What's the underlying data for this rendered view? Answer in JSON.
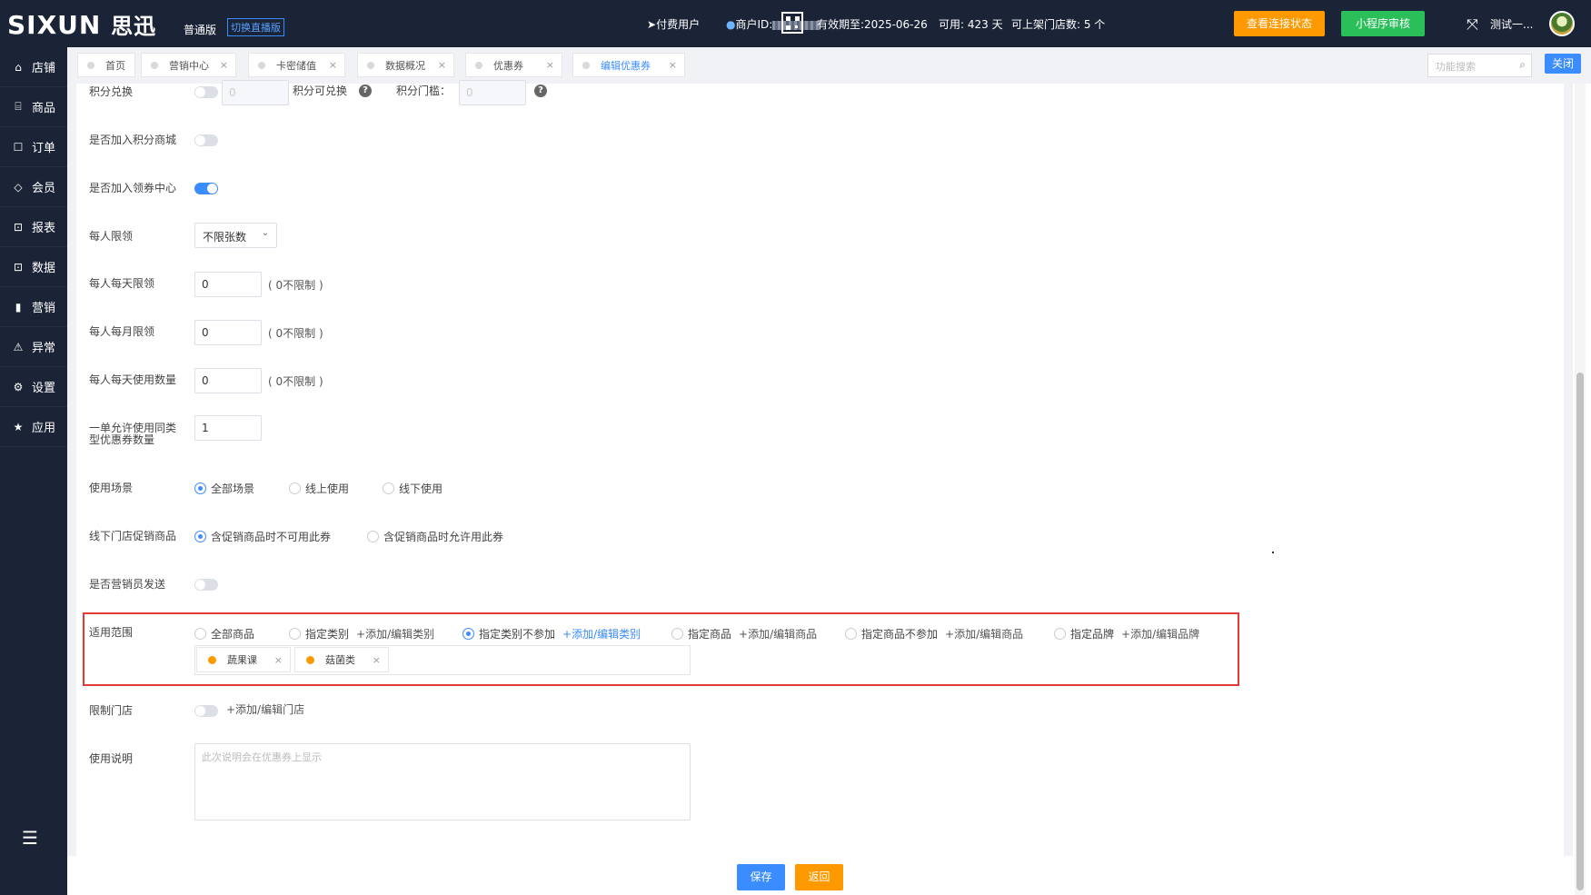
{
  "header": {
    "logo_text": "SIXUN",
    "logo_cn": "思迅",
    "edition": "普通版",
    "switch_live": "切换直播版",
    "paid_user": "付费用户",
    "merchant_id_label": "商户ID:",
    "valid_until": "有效期至:2025-06-26",
    "available_days": "可用: 423 天",
    "store_limit": "可上架门店数: 5 个",
    "check_connection": "查看连接状态",
    "miniprogram_review": "小程序审核",
    "user_name": "测试一..."
  },
  "sidebar": {
    "items": [
      {
        "label": "店铺",
        "icon": "store-icon",
        "glyph": "⌂"
      },
      {
        "label": "商品",
        "icon": "gift-icon",
        "glyph": "⌸"
      },
      {
        "label": "订单",
        "icon": "order-icon",
        "glyph": "☐"
      },
      {
        "label": "会员",
        "icon": "member-icon",
        "glyph": "◇"
      },
      {
        "label": "报表",
        "icon": "report-icon",
        "glyph": "⊡"
      },
      {
        "label": "数据",
        "icon": "data-icon",
        "glyph": "⊡"
      },
      {
        "label": "营销",
        "icon": "chart-icon",
        "glyph": "▮"
      },
      {
        "label": "异常",
        "icon": "warning-icon",
        "glyph": "⚠"
      },
      {
        "label": "设置",
        "icon": "gear-icon",
        "glyph": "⚙"
      },
      {
        "label": "应用",
        "icon": "star-icon",
        "glyph": "★"
      }
    ],
    "collapse_glyph": "☰"
  },
  "tabs": [
    {
      "label": "首页"
    },
    {
      "label": "营销中心"
    },
    {
      "label": "卡密储值"
    },
    {
      "label": "数据概况"
    },
    {
      "label": "优惠券"
    },
    {
      "label": "编辑优惠券"
    }
  ],
  "tab_close_glyph": "×",
  "func_search": {
    "placeholder": "功能搜索"
  },
  "close_all": "关闭",
  "form": {
    "points_exchange": {
      "label": "积分兑换",
      "value": "0",
      "exchangeable_label": "积分可兑换",
      "threshold_label": "积分门槛：",
      "threshold_value": "0"
    },
    "join_points_mall": {
      "label": "是否加入积分商城"
    },
    "join_coupon_center": {
      "label": "是否加入领券中心"
    },
    "per_person_limit": {
      "label": "每人限领",
      "value": "不限张数"
    },
    "daily_limit": {
      "label": "每人每天限领",
      "value": "0",
      "hint": "( 0不限制 )"
    },
    "monthly_limit": {
      "label": "每人每月限领",
      "value": "0",
      "hint": "( 0不限制 )"
    },
    "daily_use": {
      "label": "每人每天使用数量",
      "value": "0",
      "hint": "( 0不限制 )"
    },
    "same_type_per_order": {
      "label1": "一单允许使用同类",
      "label2": "型优惠券数量",
      "value": "1"
    },
    "usage_scene": {
      "label": "使用场景",
      "options": [
        "全部场景",
        "线上使用",
        "线下使用"
      ]
    },
    "offline_promo": {
      "label": "线下门店促销商品",
      "options": [
        "含促销商品时不可用此券",
        "含促销商品时允许用此券"
      ]
    },
    "sales_send": {
      "label": "是否营销员发送"
    },
    "scope": {
      "label": "适用范围",
      "options": [
        {
          "label": "全部商品",
          "link": ""
        },
        {
          "label": "指定类别",
          "link": "+添加/编辑类别"
        },
        {
          "label": "指定类别不参加",
          "link": "+添加/编辑类别"
        },
        {
          "label": "指定商品",
          "link": "+添加/编辑商品"
        },
        {
          "label": "指定商品不参加",
          "link": "+添加/编辑商品"
        },
        {
          "label": "指定品牌",
          "link": "+添加/编辑品牌"
        }
      ],
      "tags": [
        "蔬果课",
        "菇菌类"
      ]
    },
    "limit_store": {
      "label": "限制门店",
      "link": "+添加/编辑门店"
    },
    "usage_desc": {
      "label": "使用说明",
      "placeholder": "此次说明会在优惠券上显示"
    }
  },
  "actions": {
    "save": "保存",
    "back": "返回"
  },
  "colors": {
    "nav_bg": "#1b2437",
    "primary": "#3b8cff",
    "orange": "#ff9900",
    "green": "#2bbf5a",
    "highlight_border": "#e53935"
  }
}
